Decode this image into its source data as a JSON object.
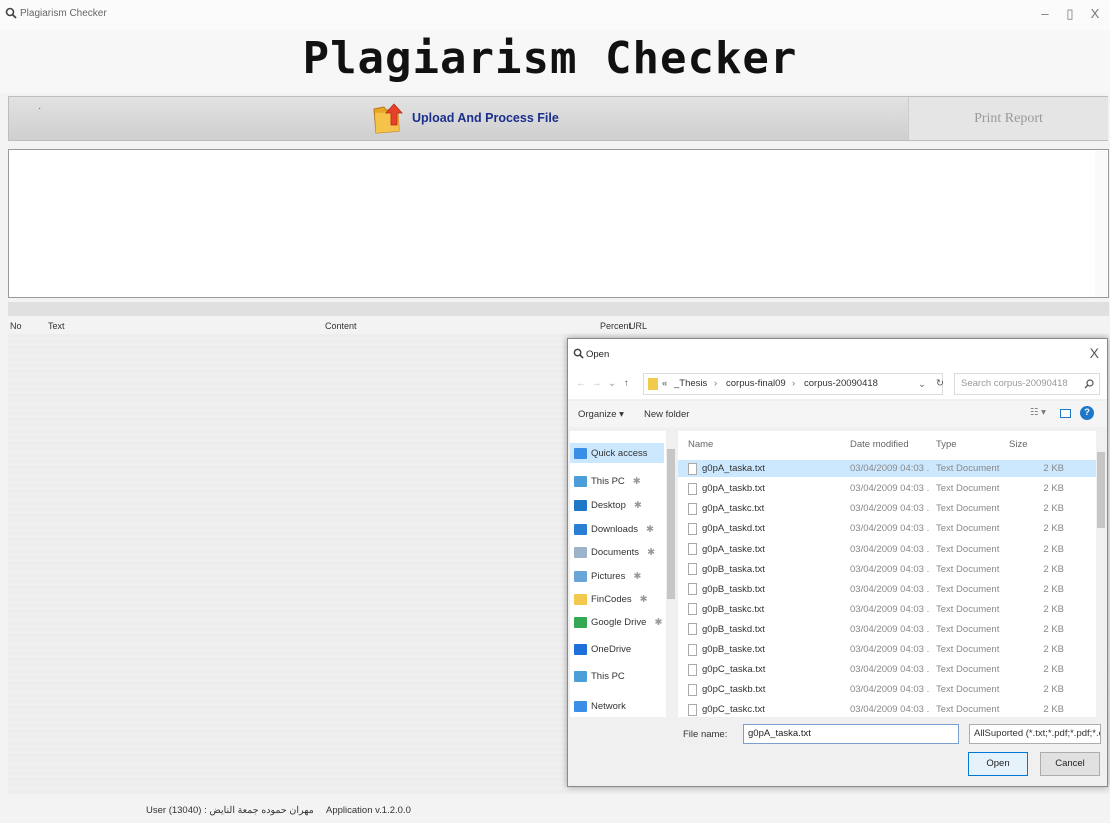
{
  "window": {
    "title": "Plagiarism Checker",
    "controls": {
      "minimize": "–",
      "maximize": "▯",
      "close": "X"
    }
  },
  "header": {
    "heading": "Plagiarism Checker"
  },
  "toolbar": {
    "dot": "·",
    "upload_label": "Upload And Process File",
    "print_label": "Print Report"
  },
  "grid": {
    "columns": [
      "No",
      "Text",
      "Content",
      "Percent",
      "URL"
    ]
  },
  "status": {
    "user": "User (13040) : مهران حموده جمعة النايض",
    "version": "Application v.1.2.0.0"
  },
  "dialog": {
    "title": "Open",
    "close": "X",
    "breadcrumb": {
      "prefix": "«",
      "parts": [
        "_Thesis",
        "corpus-final09",
        "corpus-20090418"
      ],
      "separator": "›"
    },
    "search_placeholder": "Search corpus-20090418",
    "organize_label": "Organize ▾",
    "new_folder_label": "New folder",
    "nav_items": [
      {
        "label": "Quick access",
        "icon": "star-icon",
        "color": "#3a8ee6",
        "pinned": false,
        "selected": true
      },
      {
        "label": "This PC",
        "icon": "computer-icon",
        "color": "#4b9ed9",
        "pinned": true
      },
      {
        "label": "Desktop",
        "icon": "desktop-icon",
        "color": "#1e78c8",
        "pinned": true
      },
      {
        "label": "Downloads",
        "icon": "download-icon",
        "color": "#2a7fd4",
        "pinned": true
      },
      {
        "label": "Documents",
        "icon": "documents-icon",
        "color": "#9cb3c9",
        "pinned": true
      },
      {
        "label": "Pictures",
        "icon": "pictures-icon",
        "color": "#6aa5d8",
        "pinned": true
      },
      {
        "label": "FinCodes",
        "icon": "folder-icon",
        "color": "#f2c94c",
        "pinned": true
      },
      {
        "label": "Google Drive",
        "icon": "google-drive-icon",
        "color": "#34a853",
        "pinned": true
      },
      {
        "label": "OneDrive",
        "icon": "onedrive-icon",
        "color": "#1e6fd9",
        "pinned": false
      },
      {
        "label": "This PC",
        "icon": "computer-icon",
        "color": "#4b9ed9",
        "pinned": false
      },
      {
        "label": "Network",
        "icon": "network-icon",
        "color": "#3a8ee6",
        "pinned": false
      }
    ],
    "columns": {
      "name": "Name",
      "date": "Date modified",
      "type": "Type",
      "size": "Size"
    },
    "files": [
      {
        "name": "g0pA_taska.txt",
        "date": "03/04/2009 04:03 ...",
        "type": "Text Document",
        "size": "2 KB",
        "selected": true
      },
      {
        "name": "g0pA_taskb.txt",
        "date": "03/04/2009 04:03 ...",
        "type": "Text Document",
        "size": "2 KB"
      },
      {
        "name": "g0pA_taskc.txt",
        "date": "03/04/2009 04:03 ...",
        "type": "Text Document",
        "size": "2 KB"
      },
      {
        "name": "g0pA_taskd.txt",
        "date": "03/04/2009 04:03 ...",
        "type": "Text Document",
        "size": "2 KB"
      },
      {
        "name": "g0pA_taske.txt",
        "date": "03/04/2009 04:03 ...",
        "type": "Text Document",
        "size": "2 KB"
      },
      {
        "name": "g0pB_taska.txt",
        "date": "03/04/2009 04:03 ...",
        "type": "Text Document",
        "size": "2 KB"
      },
      {
        "name": "g0pB_taskb.txt",
        "date": "03/04/2009 04:03 ...",
        "type": "Text Document",
        "size": "2 KB"
      },
      {
        "name": "g0pB_taskc.txt",
        "date": "03/04/2009 04:03 ...",
        "type": "Text Document",
        "size": "2 KB"
      },
      {
        "name": "g0pB_taskd.txt",
        "date": "03/04/2009 04:03 ...",
        "type": "Text Document",
        "size": "2 KB"
      },
      {
        "name": "g0pB_taske.txt",
        "date": "03/04/2009 04:03 ...",
        "type": "Text Document",
        "size": "2 KB"
      },
      {
        "name": "g0pC_taska.txt",
        "date": "03/04/2009 04:03 ...",
        "type": "Text Document",
        "size": "2 KB"
      },
      {
        "name": "g0pC_taskb.txt",
        "date": "03/04/2009 04:03 ...",
        "type": "Text Document",
        "size": "2 KB"
      },
      {
        "name": "g0pC_taskc.txt",
        "date": "03/04/2009 04:03 ...",
        "type": "Text Document",
        "size": "2 KB"
      }
    ],
    "filename_label": "File name:",
    "filename_value": "g0pA_taska.txt",
    "filetype_value": "AllSuported (*.txt;*.pdf;*.pdf;*.c",
    "open_label": "Open",
    "cancel_label": "Cancel"
  },
  "colors": {
    "upload_text": "#1b2f8d",
    "selection": "#cce8ff",
    "accent": "#0078d7"
  }
}
